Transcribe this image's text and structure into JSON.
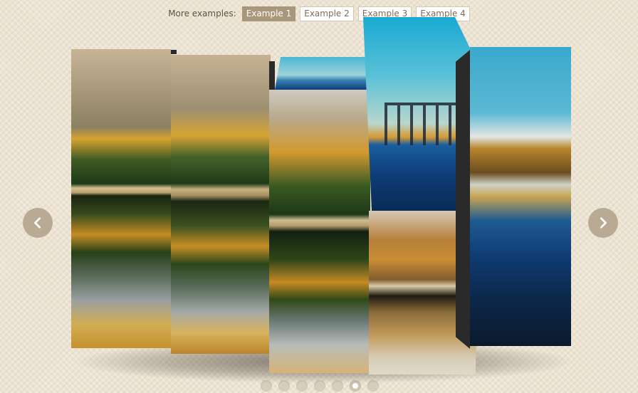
{
  "nav": {
    "label": "More examples:",
    "examples": [
      {
        "label": "Example 1",
        "active": true
      },
      {
        "label": "Example 2",
        "active": false
      },
      {
        "label": "Example 3",
        "active": false
      },
      {
        "label": "Example 4",
        "active": false
      }
    ]
  },
  "slider": {
    "slice_count": 5,
    "prev_icon": "chevron-left-icon",
    "next_icon": "chevron-right-icon",
    "dots_total": 7,
    "active_dot": 6
  },
  "colors": {
    "accent": "#a9977c",
    "background": "#ece3d2",
    "arrow": "#b3a48d"
  }
}
